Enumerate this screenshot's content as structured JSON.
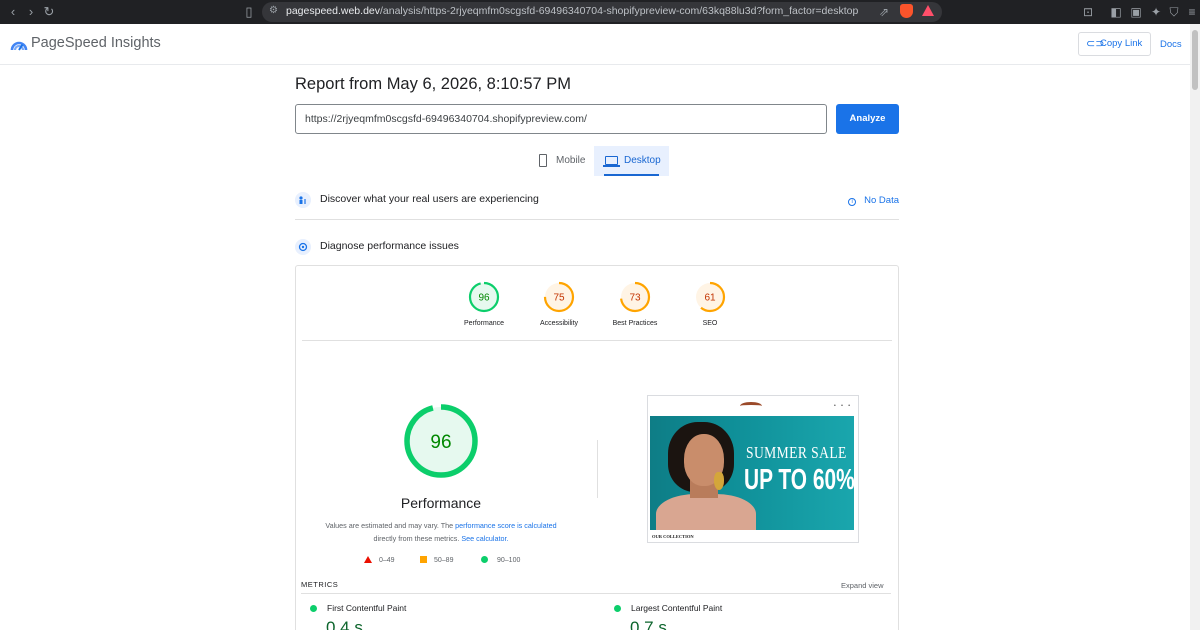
{
  "browser": {
    "url_host": "pagespeed.web.dev",
    "url_rest": "/analysis/https-2rjyeqmfm0scgsfd-69496340704-shopifypreview-com/63kq88lu3d?form_factor=desktop"
  },
  "header": {
    "app_title": "PageSpeed Insights",
    "copy_link": "Copy Link",
    "docs": "Docs"
  },
  "report": {
    "title": "Report from May 6, 2026, 8:10:57 PM",
    "url_value": "https://2rjyeqmfm0scgsfd-69496340704.shopifypreview.com/",
    "analyze_label": "Analyze"
  },
  "tabs": {
    "mobile": "Mobile",
    "desktop": "Desktop",
    "selected": "desktop"
  },
  "field_data": {
    "title": "Discover what your real users are experiencing",
    "status": "No Data"
  },
  "lab": {
    "title": "Diagnose performance issues",
    "categories": [
      {
        "label": "Performance",
        "score": 96,
        "color": "#0cce6b",
        "text_color": "#008800",
        "fill": "#e6f9ef"
      },
      {
        "label": "Accessibility",
        "score": 75,
        "color": "#ffa400",
        "text_color": "#c33300",
        "fill": "#fff4e5"
      },
      {
        "label": "Best Practices",
        "score": 73,
        "color": "#ffa400",
        "text_color": "#c33300",
        "fill": "#fff4e5"
      },
      {
        "label": "SEO",
        "score": 61,
        "color": "#ffa400",
        "text_color": "#c33300",
        "fill": "#fff4e5"
      }
    ],
    "big_score": 96,
    "big_label": "Performance",
    "note_1": "Values are estimated and may vary. The ",
    "note_link_1": "performance score is calculated",
    "note_2": "directly from these metrics. ",
    "note_link_2": "See calculator.",
    "legend": {
      "fail": "0–49",
      "average": "50–89",
      "pass": "90–100"
    }
  },
  "thumbnail": {
    "banner_line1": "SUMMER SALE",
    "banner_line2": "UP TO 60%",
    "footer_text": "OUR COLLECTION"
  },
  "metrics": {
    "label": "METRICS",
    "expand": "Expand view",
    "items": [
      {
        "name": "First Contentful Paint",
        "value": "0.4 s"
      },
      {
        "name": "Largest Contentful Paint",
        "value": "0.7 s"
      }
    ]
  }
}
